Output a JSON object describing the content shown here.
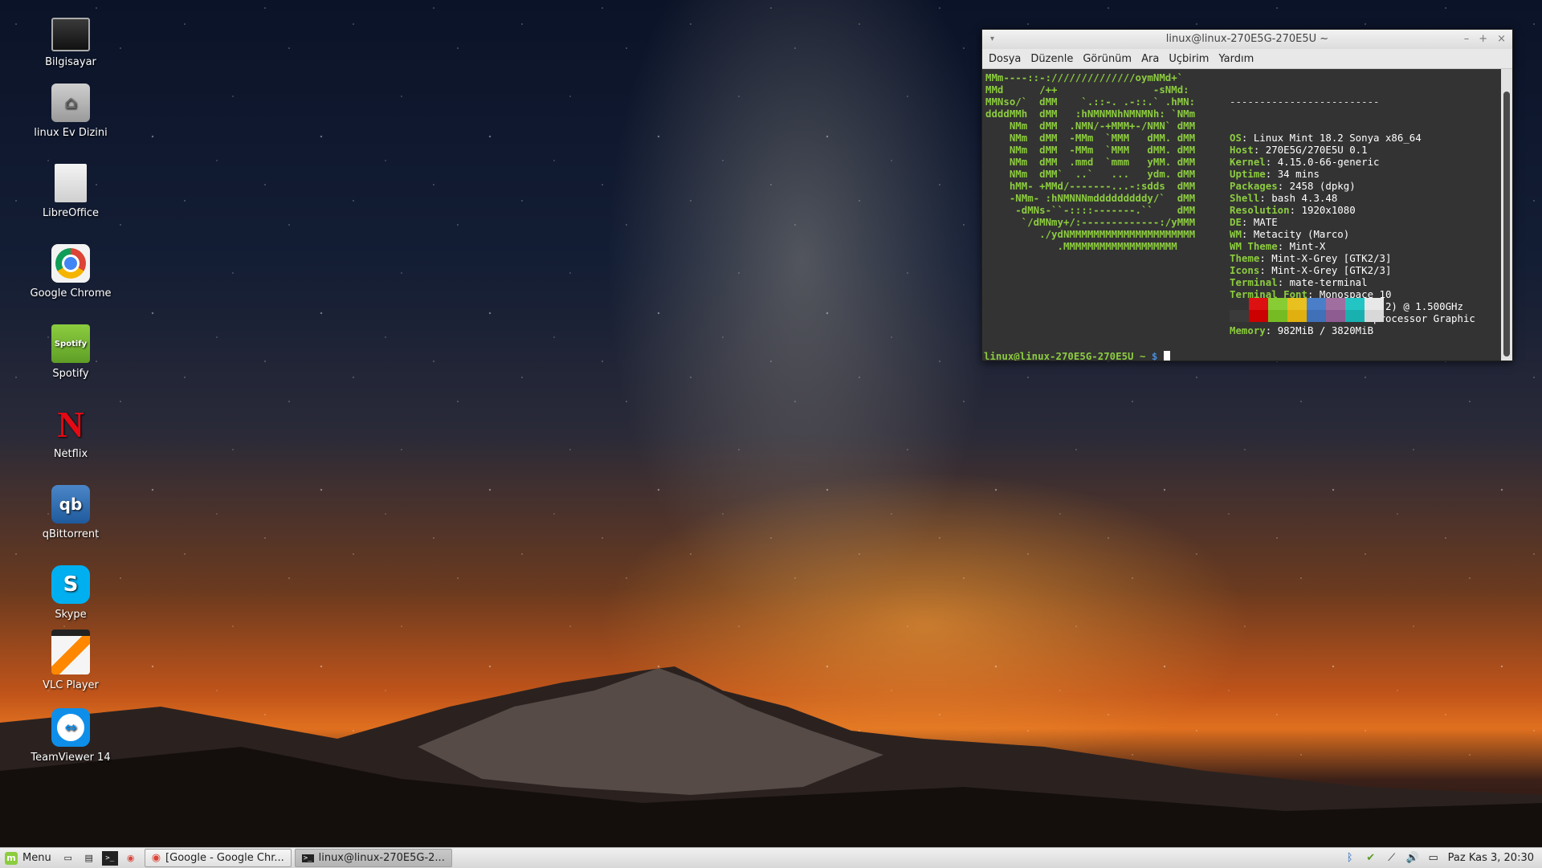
{
  "desktop": {
    "icons": [
      {
        "label": "Bilgisayar",
        "icon": "computer-icon"
      },
      {
        "label": "linux Ev Dizini",
        "icon": "home-folder-icon"
      },
      {
        "label": "LibreOffice",
        "icon": "document-icon"
      },
      {
        "label": "Google Chrome",
        "icon": "chrome-icon"
      },
      {
        "label": "Spotify",
        "icon": "spotify-icon"
      },
      {
        "label": "Netflix",
        "icon": "netflix-icon"
      },
      {
        "label": "qBittorrent",
        "icon": "qbittorrent-icon"
      },
      {
        "label": "Skype",
        "icon": "skype-icon"
      },
      {
        "label": "VLC Player",
        "icon": "vlc-icon"
      },
      {
        "label": "TeamViewer 14",
        "icon": "teamviewer-icon"
      }
    ],
    "spotify_icon_text": "Spotify",
    "netflix_icon_text": "N",
    "qbittorrent_icon_text": "qb",
    "skype_icon_text": "S"
  },
  "terminal": {
    "title": "linux@linux-270E5G-270E5U ~",
    "title_collapse_glyph": "▾",
    "buttons": {
      "minimize": "–",
      "maximize": "+",
      "close": "×"
    },
    "menu": [
      "Dosya",
      "Düzenle",
      "Görünüm",
      "Ara",
      "Uçbirim",
      "Yardım"
    ],
    "ascii_art": [
      "MMm----::-://////////////oymNMd+`",
      "MMd      /++                -sNMd:",
      "MMNso/`  dMM    `.::-. .-::.` .hMN:",
      "ddddMMh  dMM   :hNMNMNhNMNMNh: `NMm",
      "    NMm  dMM  .NMN/-+MMM+-/NMN` dMM",
      "    NMm  dMM  -MMm  `MMM   dMM. dMM",
      "    NMm  dMM  -MMm  `MMM   dMM. dMM",
      "    NMm  dMM  .mmd  `mmm   yMM. dMM",
      "    NMm  dMM`  ..`   ...   ydm. dMM",
      "    hMM- +MMd/-------...-:sdds  dMM",
      "    -NMm- :hNMNNNmdddddddddy/`  dMM",
      "     -dMNs-``-::::-------.``    dMM",
      "      `/dMNmy+/:-------------:/yMMM",
      "         ./ydNMMMMMMMMMMMMMMMMMMMMM",
      "            .MMMMMMMMMMMMMMMMMMM"
    ],
    "info_header": "-------------------------",
    "info": [
      {
        "key": "OS",
        "value": "Linux Mint 18.2 Sonya x86_64"
      },
      {
        "key": "Host",
        "value": "270E5G/270E5U 0.1"
      },
      {
        "key": "Kernel",
        "value": "4.15.0-66-generic"
      },
      {
        "key": "Uptime",
        "value": "34 mins"
      },
      {
        "key": "Packages",
        "value": "2458 (dpkg)"
      },
      {
        "key": "Shell",
        "value": "bash 4.3.48"
      },
      {
        "key": "Resolution",
        "value": "1920x1080"
      },
      {
        "key": "DE",
        "value": "MATE"
      },
      {
        "key": "WM",
        "value": "Metacity (Marco)"
      },
      {
        "key": "WM Theme",
        "value": "Mint-X"
      },
      {
        "key": "Theme",
        "value": "Mint-X-Grey [GTK2/3]"
      },
      {
        "key": "Icons",
        "value": "Mint-X-Grey [GTK2/3]"
      },
      {
        "key": "Terminal",
        "value": "mate-terminal"
      },
      {
        "key": "Terminal Font",
        "value": "Monospace 10"
      },
      {
        "key": "CPU",
        "value": "Intel Celeron 1007U (2) @ 1.500GHz"
      },
      {
        "key": "GPU",
        "value": "Intel 3rd Gen Core processor Graphic"
      },
      {
        "key": "Memory",
        "value": "982MiB / 3820MiB"
      }
    ],
    "palette": [
      {
        "top": "#333333",
        "bottom": "#3a3a3a"
      },
      {
        "top": "#dd1111",
        "bottom": "#cc0000"
      },
      {
        "top": "#88cc33",
        "bottom": "#77bb22"
      },
      {
        "top": "#e8c020",
        "bottom": "#e0b010"
      },
      {
        "top": "#4a7ec8",
        "bottom": "#3f70b8"
      },
      {
        "top": "#a16ea0",
        "bottom": "#8e5c90"
      },
      {
        "top": "#23c4c4",
        "bottom": "#19b0b0"
      },
      {
        "top": "#e8e8e8",
        "bottom": "#d8d8d8"
      }
    ],
    "prompt_user": "linux@linux-270E5G-270E5U",
    "prompt_rest": " ~ ",
    "prompt_symbol": "$"
  },
  "taskbar": {
    "menu_label": "Menu",
    "quick_launch": [
      "show-desktop-icon",
      "file-manager-icon",
      "terminal-icon",
      "chrome-icon"
    ],
    "quick_glyphs": [
      "▭",
      "▤",
      ">_",
      "◉"
    ],
    "tasks": [
      {
        "label": "[Google - Google Chr...",
        "icon": "chrome-icon",
        "glyph": "◉",
        "active": false
      },
      {
        "label": "linux@linux-270E5G-2...",
        "icon": "terminal-icon",
        "glyph": ">_",
        "active": true
      }
    ],
    "tray": [
      {
        "icon": "bluetooth-icon",
        "glyph": "ᛒ"
      },
      {
        "icon": "update-shield-icon",
        "glyph": "✔"
      },
      {
        "icon": "network-icon",
        "glyph": "⟋"
      },
      {
        "icon": "volume-icon",
        "glyph": "🔊"
      },
      {
        "icon": "battery-icon",
        "glyph": "▭"
      }
    ],
    "clock": "Paz Kas  3, 20:30"
  },
  "colors": {
    "terminal_green": "#8ccc3f",
    "terminal_bg": "#333333",
    "chrome_red": "#db4437",
    "netflix_red": "#e50914",
    "skype_blue": "#00aff0",
    "teamviewer_blue": "#0e8ee9"
  }
}
